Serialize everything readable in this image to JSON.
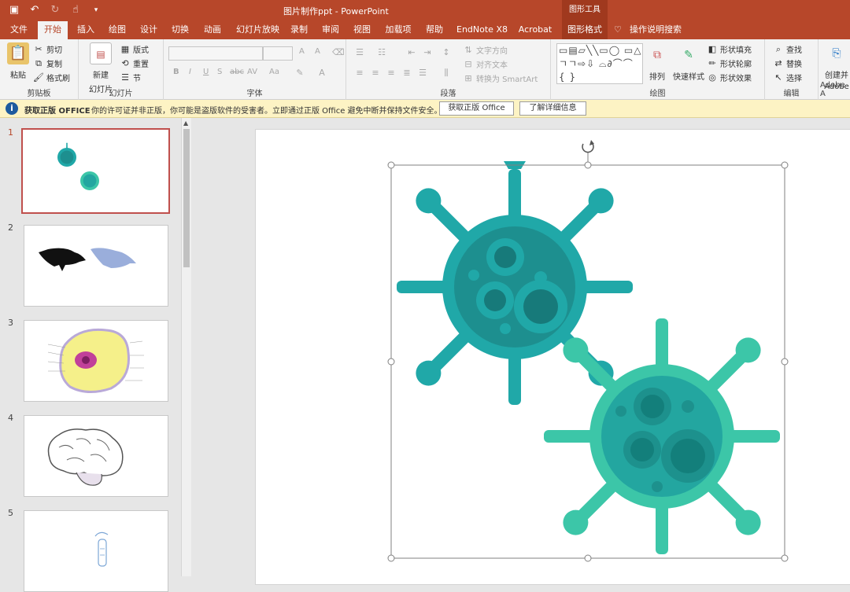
{
  "window": {
    "title": "图片制作ppt  -  PowerPoint",
    "tool_group": "图形工具",
    "qat": [
      "save-icon",
      "undo-icon",
      "redo-icon",
      "touch-mode-icon",
      "customize-icon"
    ]
  },
  "tabs": [
    {
      "label": "文件",
      "x": 0
    },
    {
      "label": "开始",
      "active": true
    },
    {
      "label": "插入"
    },
    {
      "label": "绘图"
    },
    {
      "label": "设计"
    },
    {
      "label": "切换"
    },
    {
      "label": "动画"
    },
    {
      "label": "幻灯片放映"
    },
    {
      "label": "录制"
    },
    {
      "label": "审阅"
    },
    {
      "label": "视图"
    },
    {
      "label": "加载项"
    },
    {
      "label": "帮助"
    },
    {
      "label": "EndNote X8"
    },
    {
      "label": "Acrobat"
    },
    {
      "label": "图形格式",
      "tool": true
    },
    {
      "label": "操作说明搜索"
    }
  ],
  "ribbon": {
    "clipboard": {
      "name": "剪贴板",
      "paste": "粘贴",
      "cut": "剪切",
      "copy": "复制",
      "format_painter": "格式刷"
    },
    "slides": {
      "name": "幻灯片",
      "new_slide": "新建",
      "new_slide2": "幻灯片",
      "layout": "版式",
      "reset": "重置",
      "section": "节"
    },
    "font": {
      "name": "字体",
      "bold": "B",
      "italic": "I",
      "underline": "U",
      "shadow": "S",
      "strike": "abc",
      "grow": "A",
      "shrink": "A",
      "spacing": "AV",
      "case": "Aa"
    },
    "paragraph": {
      "name": "段落",
      "text_direction": "文字方向",
      "align_text": "对齐文本",
      "smartart": "转换为 SmartArt"
    },
    "drawing": {
      "name": "绘图",
      "shapes": "▭▤▱╲╲▭◯  ▭△ㄱㄱ⇨⇩  ⌓∂⌒⌒ { }",
      "arrange": "排列",
      "quick_styles": "快速样式",
      "fill": "形状填充",
      "outline": "形状轮廓",
      "effects": "形状效果"
    },
    "editing": {
      "name": "编辑",
      "find": "查找",
      "replace": "替换",
      "select": "选择"
    },
    "adobe": {
      "name": "Adobe A",
      "create": "创建并",
      "create2": "Adobe"
    }
  },
  "infobar": {
    "label": "获取正版 OFFICE",
    "message": "你的许可证并非正版，你可能是盗版软件的受害者。立即通过正版 Office 避免中断并保持文件安全。",
    "button_genuine": "获取正版 Office",
    "button_details": "了解详细信息"
  },
  "slides": [
    {
      "number": "1",
      "content": "virus-pair",
      "active": true
    },
    {
      "number": "2",
      "content": "birds"
    },
    {
      "number": "3",
      "content": "cell-diagram"
    },
    {
      "number": "4",
      "content": "brain"
    },
    {
      "number": "5",
      "content": "test-tube"
    }
  ],
  "colors": {
    "accent": "#b7472a",
    "virus_dark": "#20a8a8",
    "virus_light": "#3cc6a8",
    "virus_core": "#1d8f8f",
    "virus_core_light": "#23a6a0",
    "selection": "#808080"
  }
}
